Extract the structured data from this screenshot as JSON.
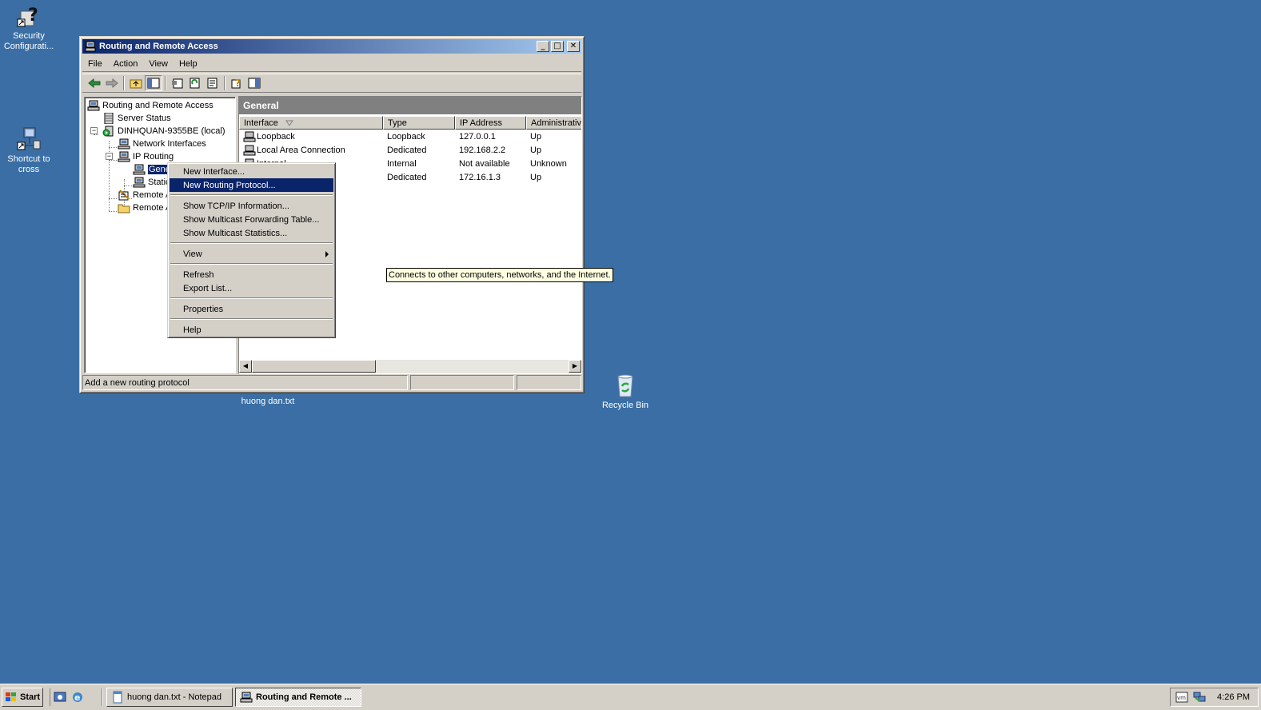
{
  "desktop": {
    "icons": [
      {
        "label": "Security Configurati..."
      },
      {
        "label": "Shortcut to cross"
      },
      {
        "label": "huong dan.txt"
      },
      {
        "label": "Recycle Bin"
      }
    ]
  },
  "window": {
    "title": "Routing and Remote Access",
    "menu": [
      "File",
      "Action",
      "View",
      "Help"
    ],
    "tree": {
      "root": "Routing and Remote Access",
      "server_status": "Server Status",
      "server": "DINHQUAN-9355BE (local)",
      "network_interfaces": "Network Interfaces",
      "ip_routing": "IP Routing",
      "general": "Gene",
      "static": "Static",
      "remote_access_1": "Remote A",
      "remote_access_2": "Remote A"
    },
    "right_pane": {
      "header": "General",
      "columns": [
        "Interface",
        "Type",
        "IP Address",
        "Administrativ"
      ],
      "rows": [
        {
          "interface": "Loopback",
          "type": "Loopback",
          "ip": "127.0.0.1",
          "admin": "Up"
        },
        {
          "interface": "Local Area Connection",
          "type": "Dedicated",
          "ip": "192.168.2.2",
          "admin": "Up"
        },
        {
          "interface": "Internal",
          "type": "Internal",
          "ip": "Not available",
          "admin": "Unknown"
        },
        {
          "interface": "",
          "type": "Dedicated",
          "ip": "172.16.1.3",
          "admin": "Up"
        }
      ]
    },
    "status_text": "Add a new routing protocol"
  },
  "context_menu": {
    "items": [
      "New Interface...",
      "New Routing Protocol...",
      "Show TCP/IP Information...",
      "Show Multicast Forwarding Table...",
      "Show Multicast Statistics...",
      "View",
      "Refresh",
      "Export List...",
      "Properties",
      "Help"
    ],
    "highlighted": "New Routing Protocol..."
  },
  "tooltip": "Connects to other computers, networks, and the Internet.",
  "taskbar": {
    "start": "Start",
    "tasks": [
      "huong dan.txt - Notepad",
      "Routing and Remote ..."
    ],
    "clock": "4:26 PM"
  },
  "colors": {
    "desktop": "#3a6ea5",
    "selection": "#0a246a",
    "chrome": "#d4d0c8"
  }
}
